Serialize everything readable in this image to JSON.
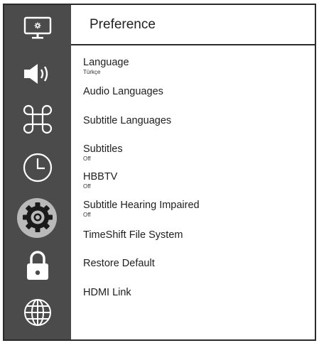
{
  "sidebar": {
    "items": [
      {
        "name": "picture",
        "icon": "monitor-icon"
      },
      {
        "name": "sound",
        "icon": "speaker-icon"
      },
      {
        "name": "apps",
        "icon": "command-icon"
      },
      {
        "name": "timer",
        "icon": "clock-icon"
      },
      {
        "name": "settings",
        "icon": "gear-icon",
        "active": true
      },
      {
        "name": "lock",
        "icon": "padlock-icon"
      },
      {
        "name": "network",
        "icon": "globe-icon"
      }
    ]
  },
  "header": {
    "title": "Preference"
  },
  "menu": {
    "items": [
      {
        "label": "Language",
        "value": "Türkçe"
      },
      {
        "label": "Audio Languages"
      },
      {
        "label": "Subtitle Languages"
      },
      {
        "label": "Subtitles",
        "value": "Off"
      },
      {
        "label": "HBBTV",
        "value": "Off"
      },
      {
        "label": "Subtitle Hearing Impaired",
        "value": "Off"
      },
      {
        "label": "TimeShift File System"
      },
      {
        "label": "Restore Default"
      },
      {
        "label": "HDMI Link"
      }
    ]
  },
  "colors": {
    "sidebar_bg": "#4b4b4b",
    "active_halo": "#b9b9b9",
    "border": "#2b2b2b",
    "text": "#1e1e1e"
  }
}
